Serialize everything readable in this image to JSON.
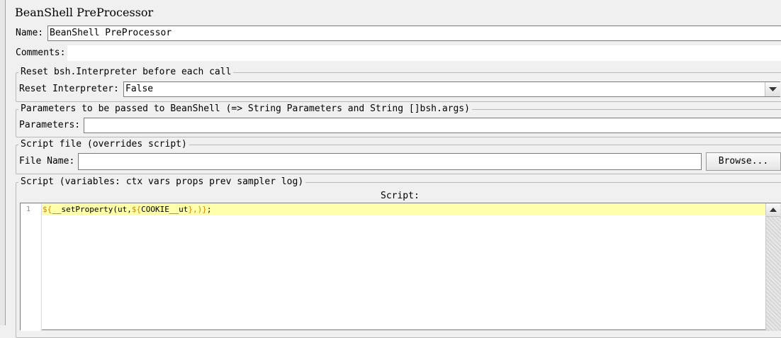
{
  "panel": {
    "title": "BeanShell PreProcessor"
  },
  "name_field": {
    "label": "Name:",
    "value": "BeanShell PreProcessor"
  },
  "comments_field": {
    "label": "Comments:",
    "value": ""
  },
  "reset_group": {
    "legend": "Reset bsh.Interpreter before each call",
    "label": "Reset Interpreter:",
    "selected": "False"
  },
  "params_group": {
    "legend": "Parameters to be passed to BeanShell (=> String Parameters and String []bsh.args)",
    "label": "Parameters:",
    "value": ""
  },
  "file_group": {
    "legend": "Script file (overrides script)",
    "label": "File Name:",
    "value": "",
    "browse_label": "Browse..."
  },
  "script_group": {
    "legend": "Script (variables: ctx vars props prev sampler log)",
    "header": "Script:",
    "lines": [
      {
        "number": "1",
        "p1": "${",
        "p2": "__setProperty(ut,",
        "p3": "${",
        "p4": "COOKIE__ut",
        "p5": "},)}",
        "p6": ";"
      }
    ]
  },
  "colors": {
    "background": "#f0f0f0",
    "current_line": "#ffffaa",
    "syntax_brace": "#d28a00"
  },
  "icons": {
    "dropdown": "chevron-down-icon",
    "scroll_up": "arrow-up-icon"
  }
}
